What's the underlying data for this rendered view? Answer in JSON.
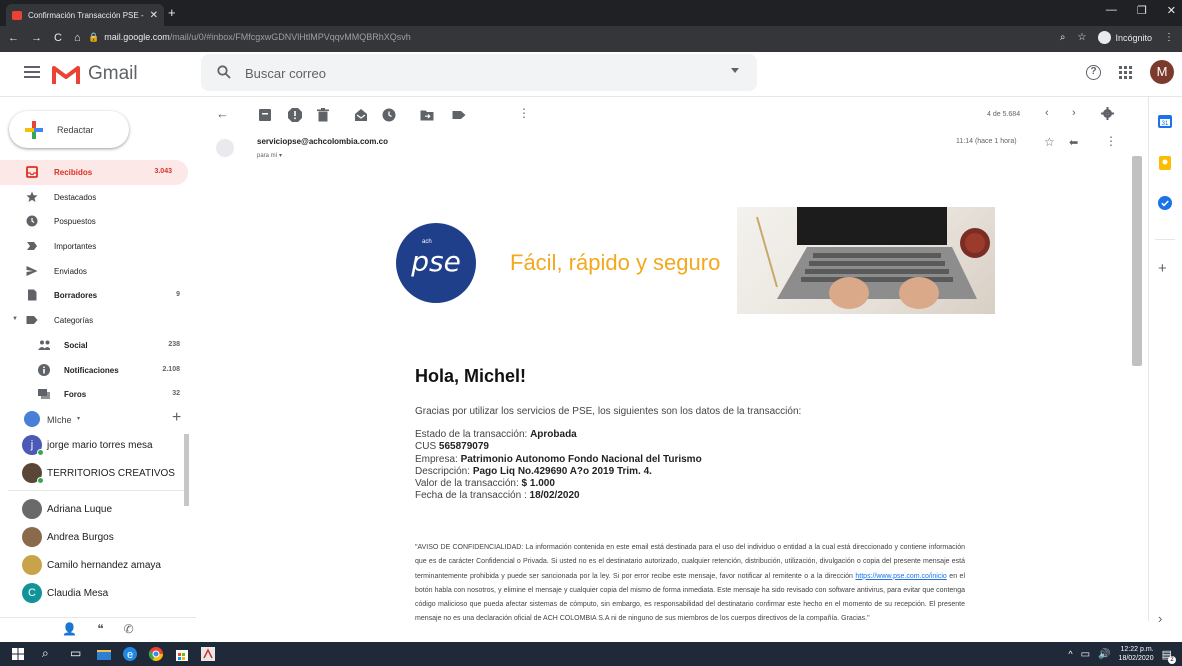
{
  "browser": {
    "tab_title": "Confirmación Transacción PSE - ",
    "url_host": "mail.google.com",
    "url_path": "/mail/u/0/#inbox/FMfcgxwGDNVlHtlMPVqqvMMQBRhXQsvh",
    "incognito_label": "Incógnito"
  },
  "gmail": {
    "logo_text": "Gmail",
    "search_placeholder": "Buscar correo",
    "avatar_letter": "M"
  },
  "sidebar": {
    "compose_label": "Redactar",
    "items": [
      {
        "label": "Recibidos",
        "count": "3.043"
      },
      {
        "label": "Destacados",
        "count": ""
      },
      {
        "label": "Pospuestos",
        "count": ""
      },
      {
        "label": "Importantes",
        "count": ""
      },
      {
        "label": "Enviados",
        "count": ""
      },
      {
        "label": "Borradores",
        "count": "9"
      },
      {
        "label": "Categorías",
        "count": ""
      },
      {
        "label": "Social",
        "count": "238"
      },
      {
        "label": "Notificaciones",
        "count": "2.108"
      },
      {
        "label": "Foros",
        "count": "32"
      }
    ]
  },
  "hangouts": {
    "me": "MIche",
    "contacts": [
      {
        "name": "jorge mario torres mesa",
        "initial": "j",
        "color": "#4a5ab5"
      },
      {
        "name": "TERRITORIOS CREATIVOS",
        "initial": "",
        "color": "#5a4636"
      },
      {
        "name": "Adriana Luque",
        "initial": "",
        "color": "#6a6a6a"
      },
      {
        "name": "Andrea Burgos",
        "initial": "",
        "color": "#8a6a4a"
      },
      {
        "name": "Camilo hernandez amaya",
        "initial": "",
        "color": "#c9a34a"
      },
      {
        "name": "Claudia Mesa",
        "initial": "C",
        "color": "#12939a"
      }
    ]
  },
  "toolbar": {
    "pagination": "4 de 5.684"
  },
  "message": {
    "sender": "serviciopse@achcolombia.com.co",
    "to": "para mí",
    "time": "11:14 (hace 1 hora)",
    "banner_tagline": "Fácil, rápido y seguro",
    "banner_logo": "pse",
    "banner_logo_small": "ach",
    "greeting": "Hola, Michel!",
    "intro": "Gracias por utilizar los servicios de PSE, los siguientes son los datos de la transacción:",
    "details": {
      "estado_label": "Estado de la transacción:",
      "estado_value": "Aprobada",
      "cus_label": "CUS",
      "cus_value": "565879079",
      "empresa_label": "Empresa:",
      "empresa_value": "Patrimonio Autonomo Fondo Nacional del Turismo",
      "descripcion_label": "Descripción:",
      "descripcion_value": "Pago Liq No.429690 A?o 2019 Trim. 4.",
      "valor_label": "Valor de la transacción:",
      "valor_value": "$ 1.000",
      "fecha_label": "Fecha de la transacción :",
      "fecha_value": "18/02/2020"
    },
    "disclaimer_before": "\"AVISO DE CONFIDENCIALIDAD: La información contenida en este email está destinada para el uso del individuo o entidad a la cual está direccionado y contiene información que es de carácter Confidencial o Privada. Si usted no es el destinatario autorizado, cualquier retención, distribución, utilización, divulgación o copia del presente mensaje está terminantemente prohibida y puede ser sancionada por la ley. Si por error recibe este mensaje, favor notificar al remitente o a la dirección ",
    "disclaimer_link": "https://www.pse.com.co/inicio",
    "disclaimer_after": " en el botón habla con nosotros, y elimine el mensaje y cualquier copia del mismo de forma inmediata. Este mensaje ha sido revisado con software antivirus, para evitar que contenga código malicioso que pueda afectar sistemas de cómputo, sin embargo, es responsabilidad del destinatario confirmar este hecho en el momento de su recepción. El presente mensaje no es una declaración oficial de ACH COLOMBIA S.A ni de ninguno de sus miembros de los cuerpos directivos de la compañía. Gracias.\""
  },
  "taskbar": {
    "time": "12:22 p.m.",
    "date": "18/02/2020",
    "notif_count": "2"
  },
  "colors": {
    "gmail_red": "#ea4335",
    "active_bg": "#fce8e6",
    "pse_blue": "#1f3f8a",
    "pse_orange": "#f4a81d"
  }
}
